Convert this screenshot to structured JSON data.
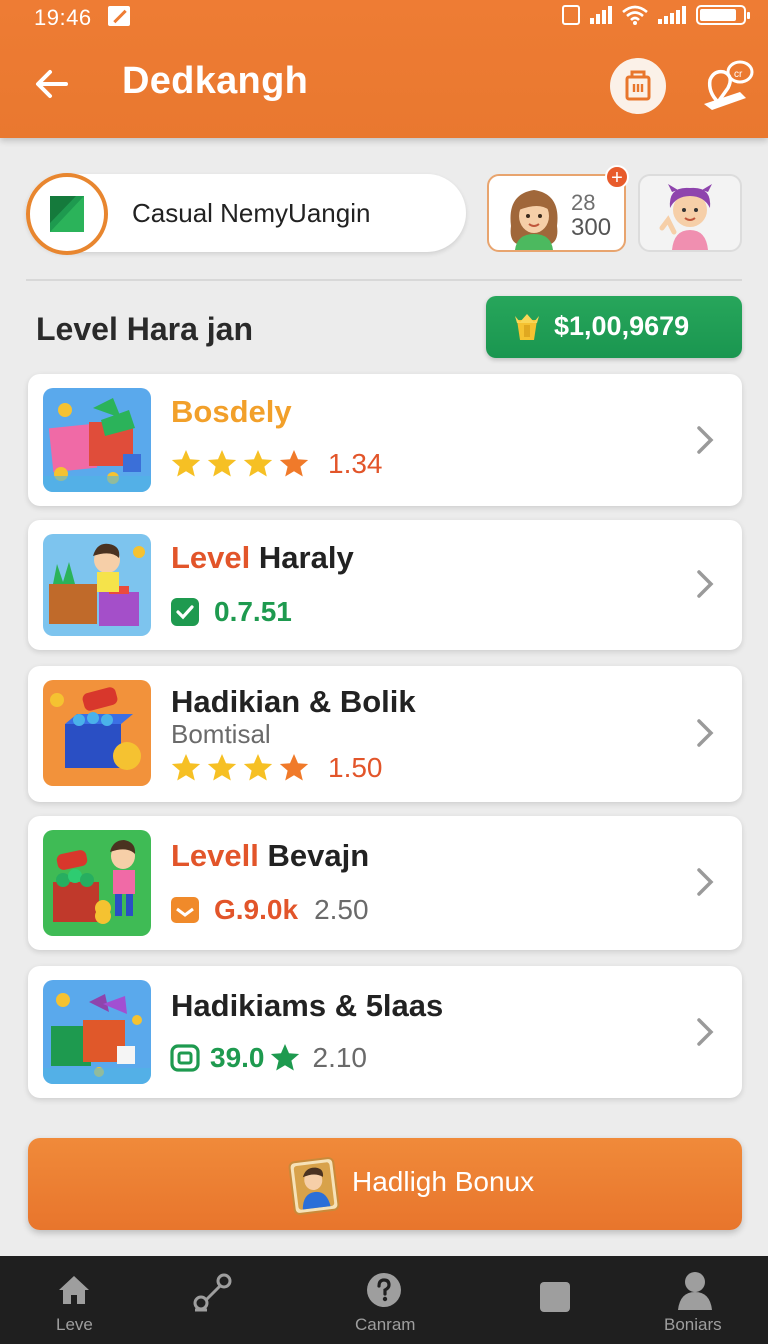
{
  "status_bar": {
    "time": "19:46"
  },
  "header": {
    "title": "Dedkangh"
  },
  "profile": {
    "name": "Casual NemyUangin"
  },
  "friend": {
    "num_top": "28",
    "num_bottom": "300",
    "badge": "+"
  },
  "section": {
    "title": "Level Hara jan",
    "coins": "$1,00,9679"
  },
  "levels": [
    {
      "title": "Bosdely",
      "rating": "1.34"
    },
    {
      "title_accent": "Level",
      "title_rest": "Haraly",
      "value": "0.7.51"
    },
    {
      "title": "Hadikian & Bolik",
      "subtitle": "Bomtisal",
      "rating": "1.50"
    },
    {
      "title_accent": "Levell",
      "title_rest": "Bevajn",
      "value": "G.9.0k",
      "secondary": "2.50"
    },
    {
      "title": "Hadikiams & 5laas",
      "value": "39.0",
      "secondary": "2.10"
    }
  ],
  "bonus": {
    "label": "Hadligh Bonux"
  },
  "nav": [
    {
      "label": "Leve",
      "icon": "home-icon"
    },
    {
      "label": "",
      "icon": "route-icon"
    },
    {
      "label": "Canram",
      "icon": "help-icon"
    },
    {
      "label": "",
      "icon": "square-icon"
    },
    {
      "label": "Boniars",
      "icon": "profile-icon"
    }
  ],
  "colors": {
    "header": "#ee7c34",
    "coin_button": "#1f9a54",
    "accent_red": "#e2552a",
    "star": "#f6c024",
    "star_partial": "#f07a2a",
    "green_value": "#1e9a4f"
  }
}
